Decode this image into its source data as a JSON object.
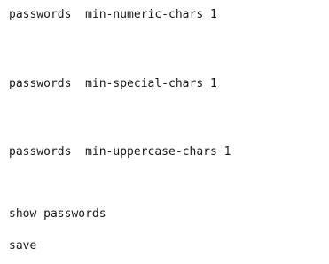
{
  "console": {
    "lines": [
      "passwords  min-numeric-chars 1",
      "passwords  min-special-chars 1",
      "passwords  min-uppercase-chars 1",
      "show passwords",
      "save"
    ]
  },
  "colors": {
    "background": "#ffffff",
    "text": "#1a1a1a"
  }
}
